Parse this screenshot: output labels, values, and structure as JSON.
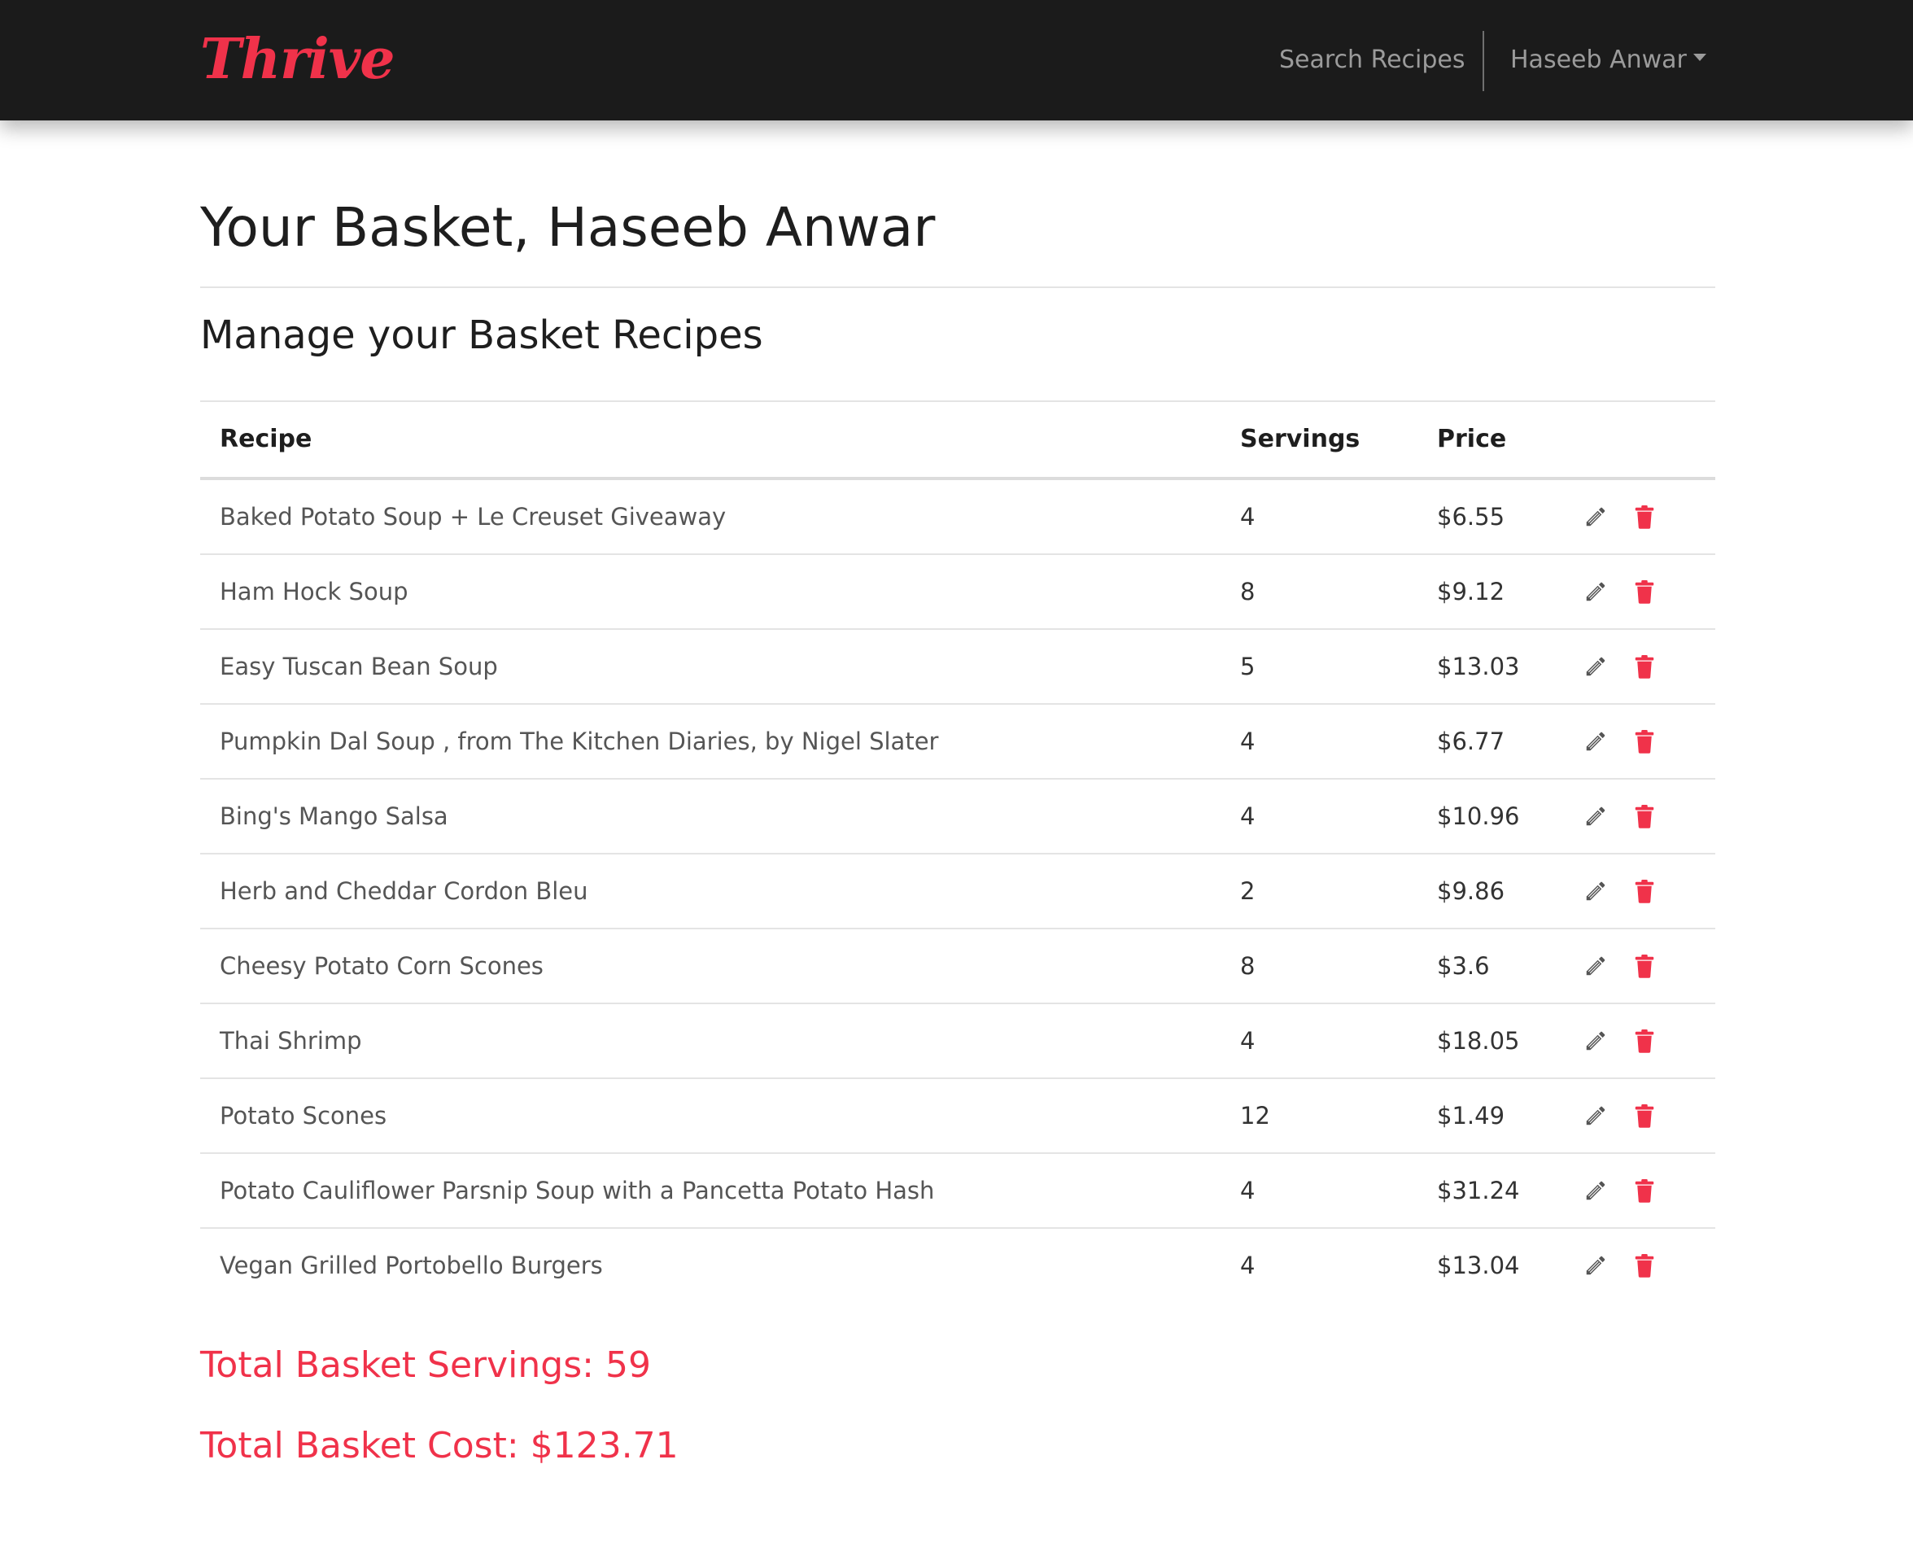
{
  "nav": {
    "brand": "Thrive",
    "search_label": "Search Recipes",
    "user_label": "Haseeb Anwar",
    "bg_color": "#1b1b1b",
    "brand_color": "#f0324a"
  },
  "page": {
    "title": "Your Basket, Haseeb Anwar",
    "subtitle": "Manage your Basket Recipes"
  },
  "table": {
    "headers": {
      "recipe": "Recipe",
      "servings": "Servings",
      "price": "Price"
    },
    "rows": [
      {
        "recipe": "Baked Potato Soup + Le Creuset Giveaway",
        "servings": "4",
        "price": "$6.55"
      },
      {
        "recipe": "Ham Hock Soup",
        "servings": "8",
        "price": "$9.12"
      },
      {
        "recipe": "Easy Tuscan Bean Soup",
        "servings": "5",
        "price": "$13.03"
      },
      {
        "recipe": "Pumpkin Dal Soup , from The Kitchen Diaries, by Nigel Slater",
        "servings": "4",
        "price": "$6.77"
      },
      {
        "recipe": "Bing's Mango Salsa",
        "servings": "4",
        "price": "$10.96"
      },
      {
        "recipe": "Herb and Cheddar Cordon Bleu",
        "servings": "2",
        "price": "$9.86"
      },
      {
        "recipe": "Cheesy Potato Corn Scones",
        "servings": "8",
        "price": "$3.6"
      },
      {
        "recipe": "Thai Shrimp",
        "servings": "4",
        "price": "$18.05"
      },
      {
        "recipe": "Potato Scones",
        "servings": "12",
        "price": "$1.49"
      },
      {
        "recipe": "Potato Cauliflower Parsnip Soup with a Pancetta Potato Hash",
        "servings": "4",
        "price": "$31.24"
      },
      {
        "recipe": "Vegan Grilled Portobello Burgers",
        "servings": "4",
        "price": "$13.04"
      }
    ],
    "row_icons": {
      "edit": "pencil-icon",
      "delete": "trash-icon",
      "edit_color": "#555555",
      "delete_color": "#f0324a"
    }
  },
  "totals": {
    "servings_text": "Total Basket Servings: 59",
    "cost_text": "Total Basket Cost: $123.71",
    "color": "#f0324a"
  }
}
